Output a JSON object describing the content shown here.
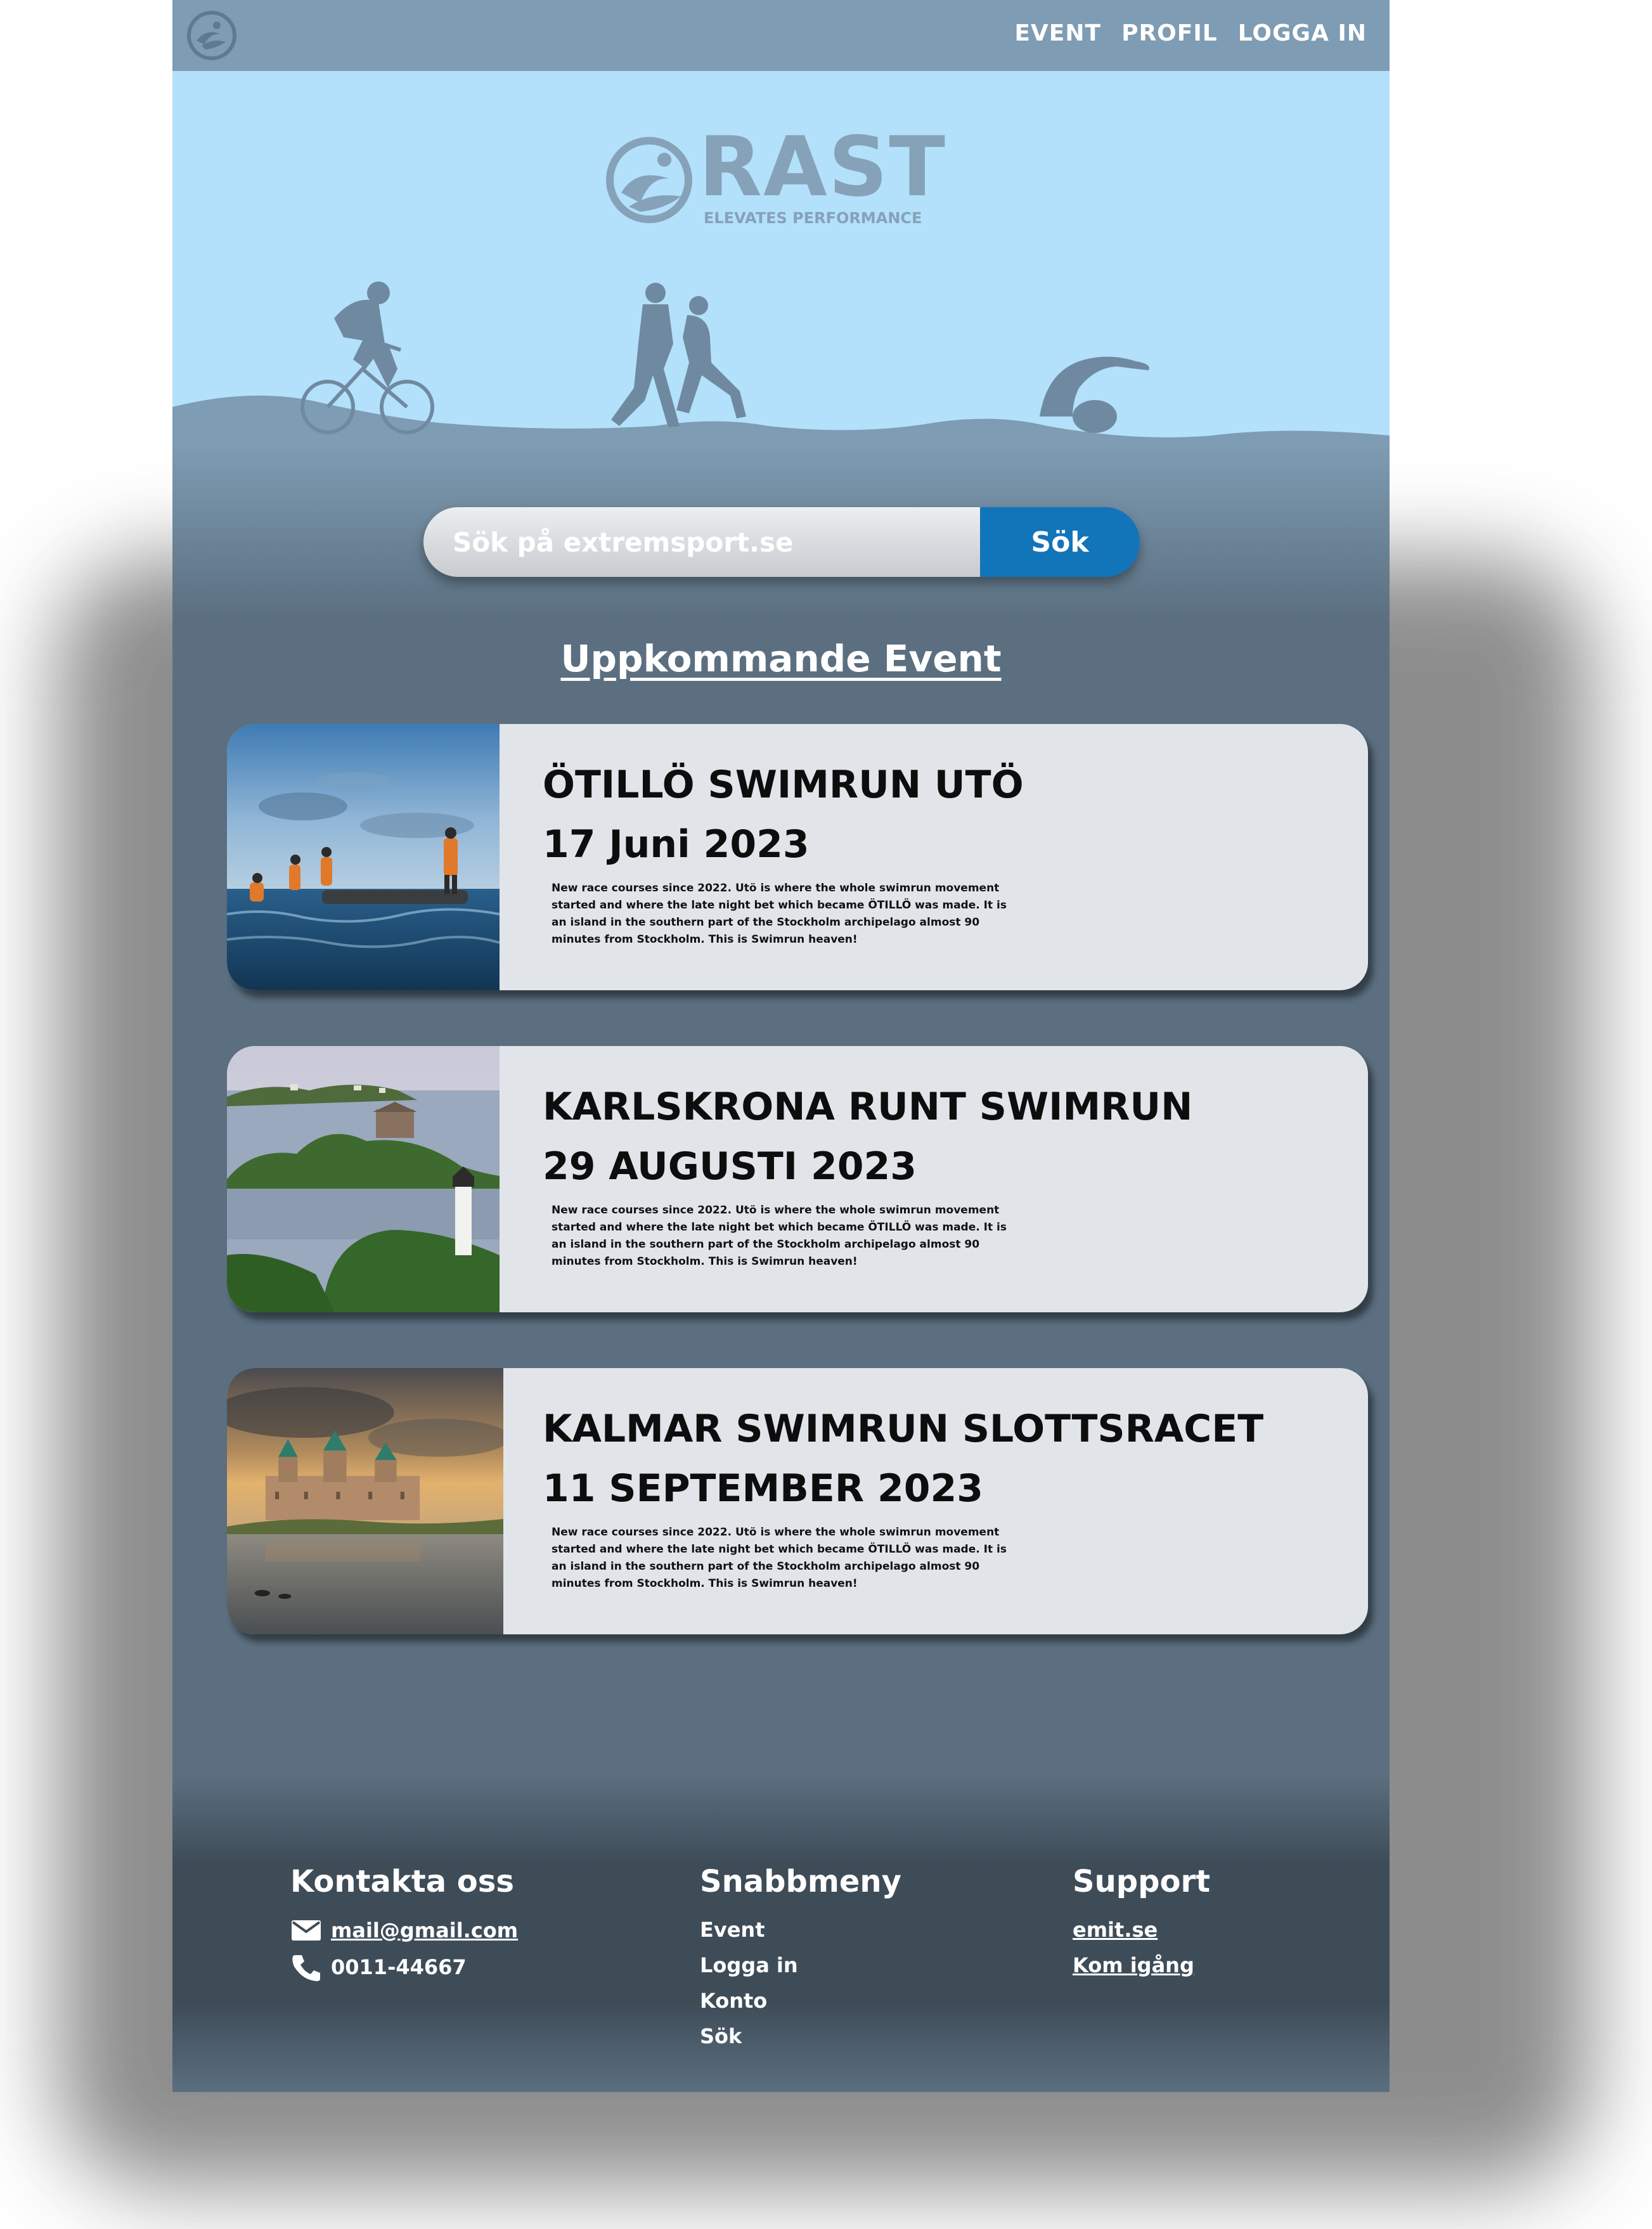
{
  "nav": {
    "links": [
      "EVENT",
      "PROFIL",
      "LOGGA IN"
    ]
  },
  "brand": {
    "name": "RAST",
    "tagline": "ELEVATES PERFORMANCE"
  },
  "search": {
    "placeholder": "Sök på extremsport.se",
    "button_label": "Sök"
  },
  "section": {
    "title": "Uppkommande Event"
  },
  "events": [
    {
      "title": "ÖTILLÖ SWIMRUN UTÖ",
      "date": "17 Juni 2023",
      "description": "New race courses since 2022. Utö is where the whole swimrun movement started and where the late night bet which became ÖTILLÖ was made. It is an island in the southern part of the Stockholm archipelago almost 90 minutes from Stockholm. This is Swimrun heaven!"
    },
    {
      "title": "KARLSKRONA RUNT SWIMRUN",
      "date": "29 AUGUSTI 2023",
      "description": "New race courses since 2022. Utö is where the whole swimrun movement started and where the late night bet which became ÖTILLÖ was made. It is an island in the southern part of the Stockholm archipelago almost 90 minutes from Stockholm. This is Swimrun heaven!"
    },
    {
      "title": "KALMAR SWIMRUN SLOTTSRACET",
      "date": "11 SEPTEMBER 2023",
      "description": "New race courses since 2022. Utö is where the whole swimrun movement started and where the late night bet which became ÖTILLÖ was made. It is an island in the southern part of the Stockholm archipelago almost 90 minutes from Stockholm. This is Swimrun heaven!"
    }
  ],
  "footer": {
    "contact": {
      "heading": "Kontakta oss",
      "email": "mail@gmail.com",
      "phone": "0011-44667",
      "email_icon": "mail-icon",
      "phone_icon": "phone-icon"
    },
    "quick": {
      "heading": "Snabbmeny",
      "items": [
        "Event",
        "Logga in",
        "Konto",
        "Sök"
      ]
    },
    "support": {
      "heading": "Support",
      "items": [
        "emit.se",
        "Kom igång"
      ]
    }
  },
  "colors": {
    "nav": "#7e9cb3",
    "hero_sky": "#b3e0fb",
    "page_bg": "#5b6f80",
    "card_bg": "#e1e5e9",
    "search_button": "#1274b9",
    "footer_bg": "#3e4c58"
  }
}
